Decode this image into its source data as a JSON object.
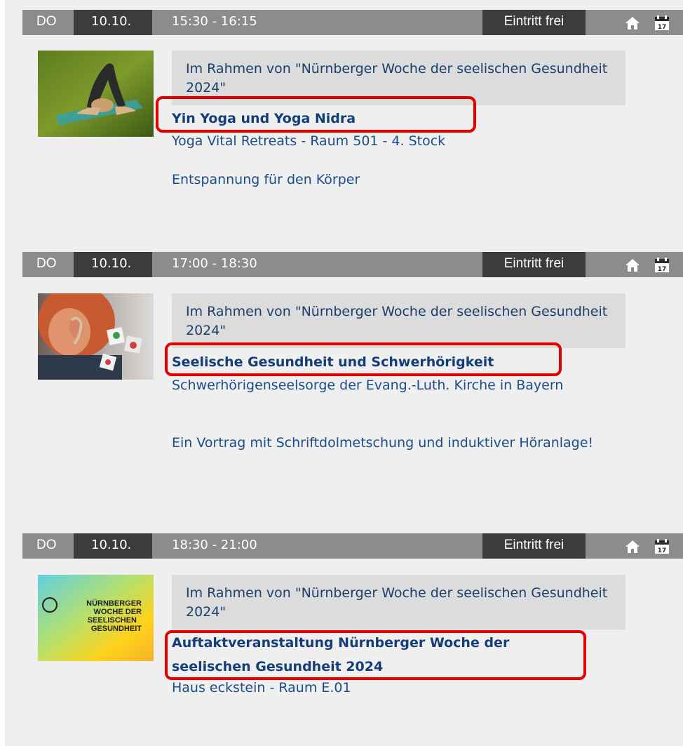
{
  "events": [
    {
      "day": "DO",
      "date": "10.10.",
      "time": "15:30 - 16:15",
      "admission": "Eintritt frei",
      "context": "Im Rahmen von \"Nürnberger Woche der seelischen Gesundheit 2024\"",
      "title": "Yin Yoga und Yoga Nidra",
      "venue": "Yoga Vital Retreats - Raum 501 - 4. Stock",
      "description": "Entspannung für den Körper",
      "image": "yoga-photo"
    },
    {
      "day": "DO",
      "date": "10.10.",
      "time": "17:00 - 18:30",
      "admission": "Eintritt frei",
      "context": "Im Rahmen von \"Nürnberger Woche der seelischen Gesundheit 2024\"",
      "title": "Seelische Gesundheit und Schwerhörigkeit",
      "venue": "Schwerhörigenseelsorge der Evang.-Luth. Kirche in Bayern",
      "description": "Ein Vortrag mit Schriftdolmetschung und induktiver Höranlage!",
      "image": "hearing-aid-photo"
    },
    {
      "day": "DO",
      "date": "10.10.",
      "time": "18:30 - 21:00",
      "admission": "Eintritt frei",
      "context": "Im Rahmen von \"Nürnberger Woche der seelischen Gesundheit 2024\"",
      "title": "Auftaktveranstaltung Nürnberger Woche der seelischen Gesundheit 2024",
      "venue": "Haus eckstein - Raum E.01",
      "description": "",
      "image": "nuernberger-woche-logo",
      "logo_text": "NÜRNBERGER WOCHE DER SEELISCHEN GESUNDHEIT"
    }
  ],
  "icons": {
    "home": "home-icon",
    "calendar": "calendar-icon",
    "calendar_number": "17"
  },
  "colors": {
    "bar": "#8c8c8c",
    "bar_dark": "#3c3c3c",
    "link": "#143e7a",
    "highlight": "#e50000"
  }
}
